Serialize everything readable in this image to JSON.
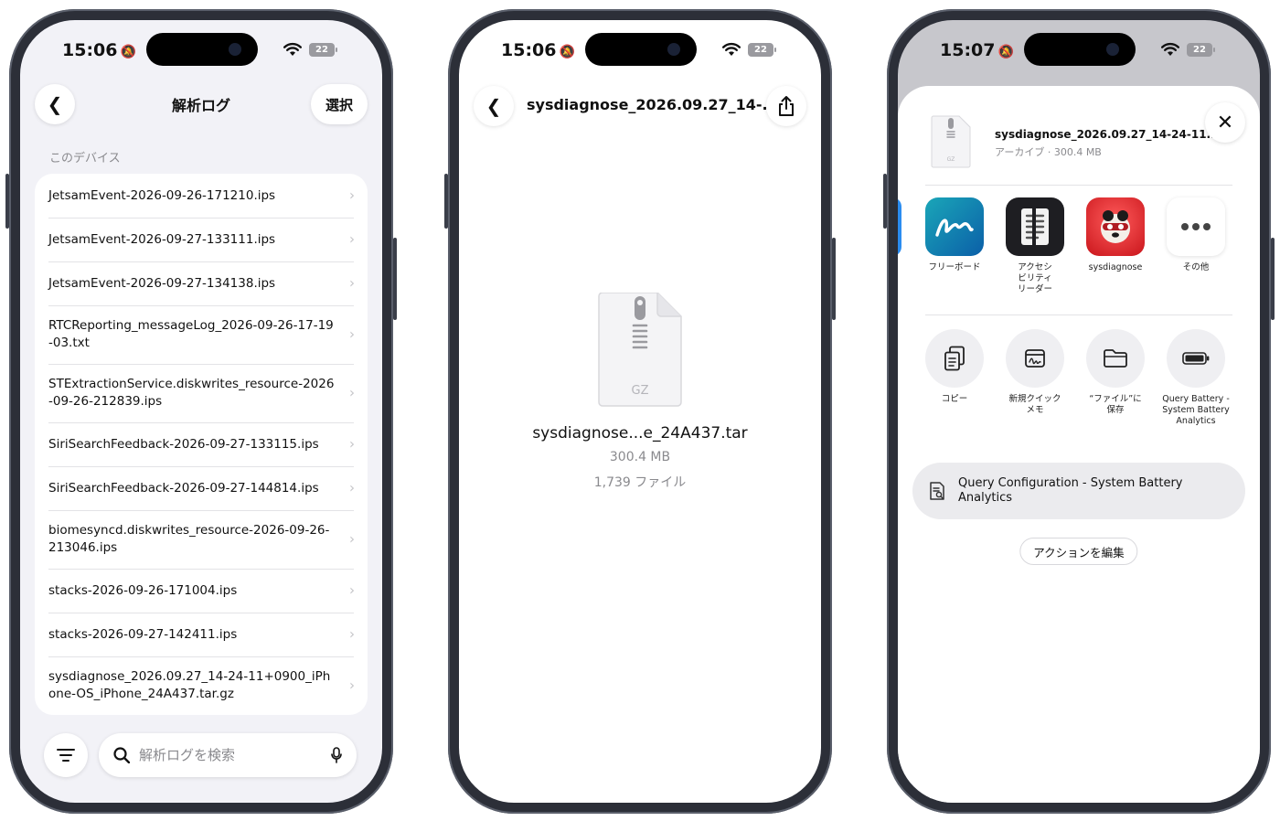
{
  "phone1": {
    "time": "15:06",
    "battery": "22",
    "nav": {
      "title": "解析ログ",
      "select_label": "選択"
    },
    "section_label": "このデバイス",
    "files": [
      "JetsamEvent-2026-09-26-171210.ips",
      "JetsamEvent-2026-09-27-133111.ips",
      "JetsamEvent-2026-09-27-134138.ips",
      "RTCReporting_messageLog_2026-09-26-17-19-03.txt",
      "STExtractionService.diskwrites_resource-2026-09-26-212839.ips",
      "SiriSearchFeedback-2026-09-27-133115.ips",
      "SiriSearchFeedback-2026-09-27-144814.ips",
      "biomesyncd.diskwrites_resource-2026-09-26-213046.ips",
      "stacks-2026-09-26-171004.ips",
      "stacks-2026-09-27-142411.ips",
      "sysdiagnose_2026.09.27_14-24-11+0900_iPhone-OS_iPhone_24A437.tar.gz"
    ],
    "search": {
      "placeholder": "解析ログを検索",
      "value": ""
    }
  },
  "phone2": {
    "time": "15:06",
    "battery": "22",
    "title": "sysdiagnose_2026.09.27_14-...",
    "file_badge": "GZ",
    "file_name": "sysdiagnose...e_24A437.tar",
    "file_size": "300.4 MB",
    "file_count": "1,739 ファイル"
  },
  "phone3": {
    "time": "15:07",
    "battery": "22",
    "file_name": "sysdiagnose_2026.09.27_14-24-11...",
    "file_meta": "アーカイブ · 300.4 MB",
    "file_badge": "GZ",
    "apps": [
      {
        "label": "フリーボード",
        "icon": "freeform-icon"
      },
      {
        "label": "アクセシビリティリーダー",
        "icon": "accessibility-reader-icon"
      },
      {
        "label": "sysdiagnose",
        "icon": "sysdiagnose-icon"
      },
      {
        "label": "その他",
        "icon": "more-icon"
      }
    ],
    "actions": [
      {
        "label": "コピー",
        "icon": "copy-icon"
      },
      {
        "label": "新規クイックメモ",
        "icon": "quick-note-icon"
      },
      {
        "label": "“ファイル”に保存",
        "icon": "folder-icon"
      },
      {
        "label": "Query Battery - System Battery Analytics",
        "icon": "battery-icon"
      }
    ],
    "shortcut_label": "Query Configuration - System Battery Analytics",
    "edit_actions_label": "アクションを編集"
  },
  "colors": {
    "background": "#f2f2f7",
    "frame": "#2c2f38",
    "accent": "#111111"
  }
}
